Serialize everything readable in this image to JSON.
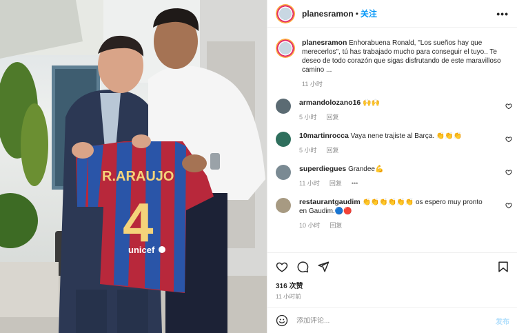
{
  "photo": {
    "jersey_name": "R.ARAUJO",
    "jersey_number": "4",
    "sponsor": "unicef"
  },
  "post": {
    "username": "planesramon",
    "follow_label": "关注",
    "more_label": "•••"
  },
  "caption": {
    "username": "planesramon",
    "text": "Enhorabuena Ronald, \"Los sueños hay que merecerlos\", tú has trabajado mucho para conseguir el tuyo.. Te deseo de todo corazón que sigas disfrutando de este maravilloso camino ...",
    "time": "11 小时"
  },
  "comments": [
    {
      "username": "armandolozano16",
      "text": "🙌🙌",
      "time": "5 小时",
      "reply": "回复",
      "extra": "",
      "avatar_color": "#5b6b73"
    },
    {
      "username": "10martinrocca",
      "text": "Vaya nene trajiste al Barça. 👏👏👏",
      "time": "5 小时",
      "reply": "回复",
      "extra": "",
      "avatar_color": "#2f6f5d"
    },
    {
      "username": "superdiegues",
      "text": "Grandee💪",
      "time": "11 小时",
      "reply": "回复",
      "extra": "•••",
      "avatar_color": "#7a8a93"
    },
    {
      "username": "restaurantgaudim",
      "text": "👏👏👏👏👏👏 os espero muy pronto en Gaudim.🔵🔴",
      "time": "10 小时",
      "reply": "回复",
      "extra": "",
      "avatar_color": "#a79a82"
    }
  ],
  "stats": {
    "likes": "316 次赞",
    "time": "11 小时前"
  },
  "add_comment": {
    "placeholder": "添加评论...",
    "post_label": "发布"
  },
  "colors": {
    "accent": "#0095f6",
    "post_disabled": "#b2dffc",
    "muted": "#8e8e8e"
  }
}
